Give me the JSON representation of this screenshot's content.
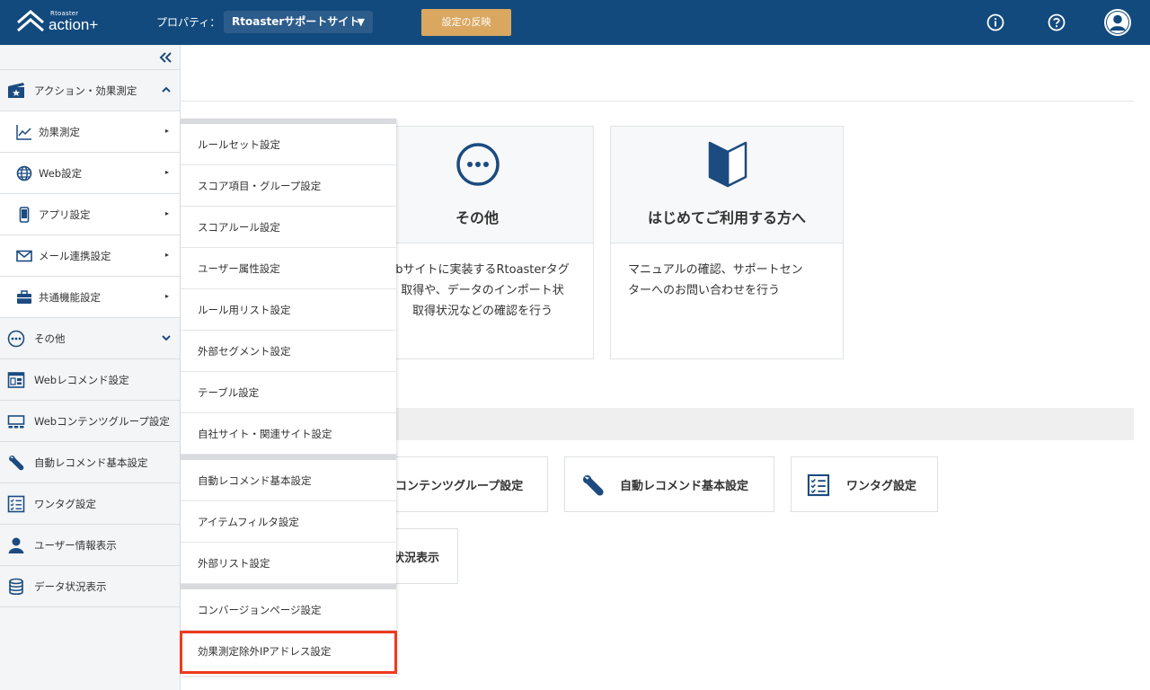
{
  "header": {
    "logo_small": "Rtoaster",
    "logo_big": "action+",
    "property_label": "プロパティ：",
    "property_value": "Rtoasterサポートサイト",
    "property_caret": "▼",
    "apply_label": "設定の反映"
  },
  "sidebar": {
    "sections": [
      {
        "label": "アクション・効果測定"
      },
      {
        "label": "効果測定"
      },
      {
        "label": "Web設定"
      },
      {
        "label": "アプリ設定"
      },
      {
        "label": "メール連携設定"
      },
      {
        "label": "共通機能設定"
      },
      {
        "label": "その他"
      },
      {
        "label": "Webレコメンド設定"
      },
      {
        "label": "Webコンテンツグループ設定"
      },
      {
        "label": "自動レコメンド基本設定"
      },
      {
        "label": "ワンタグ設定"
      },
      {
        "label": "ユーザー情報表示"
      },
      {
        "label": "データ状況表示"
      }
    ],
    "arrow_glyph": "▸"
  },
  "dropdown": {
    "items": [
      "ルールセット設定",
      "スコア項目・グループ設定",
      "スコアルール設定",
      "ユーザー属性設定",
      "ルール用リスト設定",
      "外部セグメント設定",
      "テーブル設定",
      "自社サイト・関連サイト設定",
      "自動レコメンド基本設定",
      "アイテムフィルタ設定",
      "外部リスト設定",
      "コンバージョンページ設定",
      "効果測定除外IPアドレス設定"
    ]
  },
  "cards": [
    {
      "title": "その他",
      "desc": [
        "bサイトに実装するRtoasterタグ",
        "取得や、データのインポート状",
        "取得状況などの確認を行う"
      ]
    },
    {
      "title": "はじめてご利用する方へ",
      "desc": [
        "マニュアルの確認、サポートセン",
        "ターへのお問い合わせを行う"
      ]
    }
  ],
  "quick": {
    "content_group": "コンテンツグループ設定",
    "auto_recommend": "自動レコメンド基本設定",
    "one_tag": "ワンタグ設定",
    "status": "状況表示"
  },
  "colors": {
    "header": "#124a7e",
    "accent": "#1b4b80",
    "apply": "#d9a760",
    "highlight": "#ee3a1f"
  }
}
